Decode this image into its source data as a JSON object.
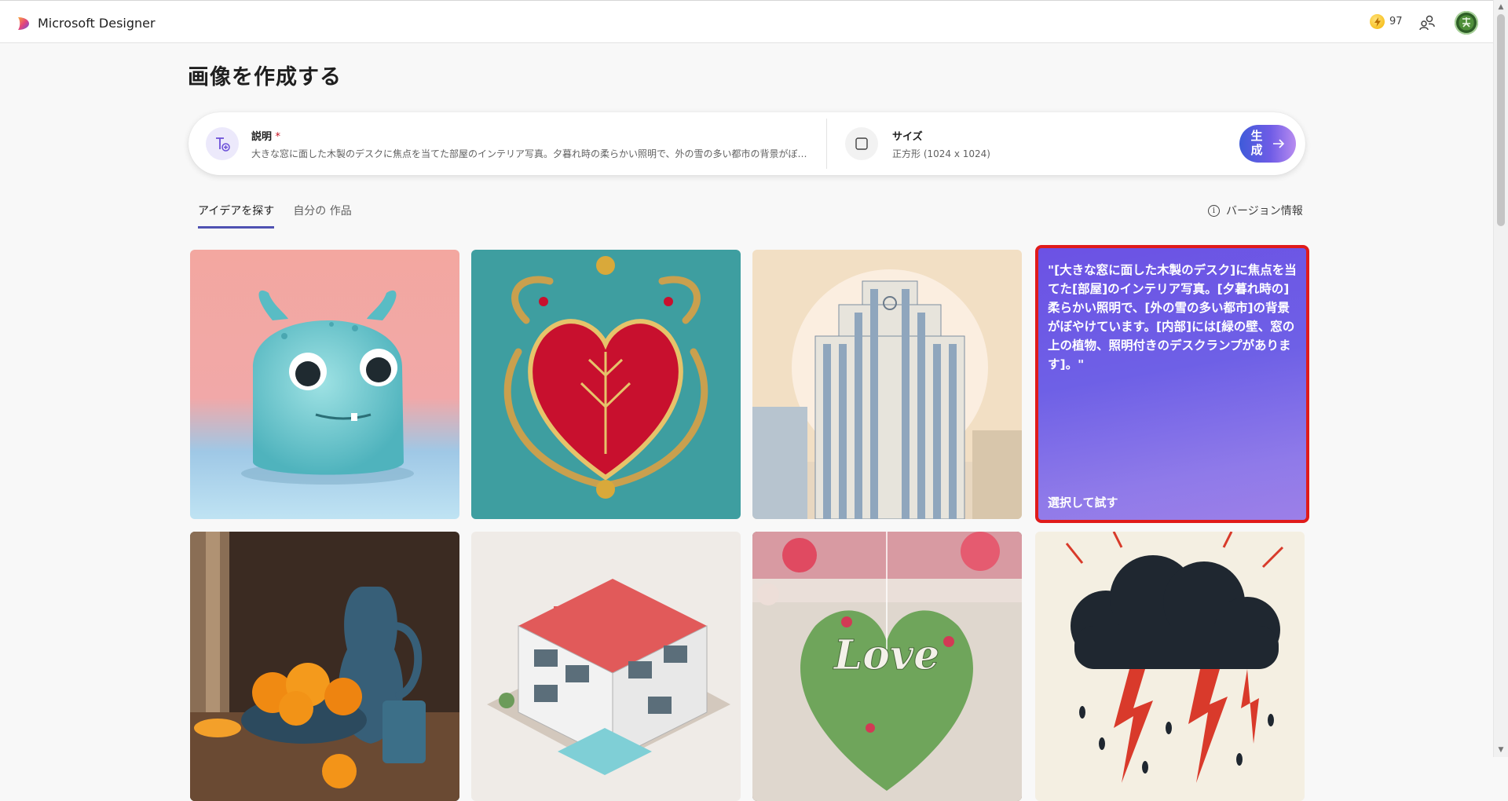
{
  "app": {
    "name": "Microsoft Designer",
    "credits": "97"
  },
  "page": {
    "title": "画像を作成する"
  },
  "prompt": {
    "description_label": "説明",
    "required_mark": "*",
    "description_text": "大きな窓に面した木製のデスクに焦点を当てた部屋のインテリア写真。夕暮れ時の柔らかい照明で、外の雪の多い都市の背景がぼやけています。内部には緑の壁、窓の上の植物、照明付きのデスクランプがあります。",
    "size_label": "サイズ",
    "size_value": "正方形 (1024 x 1024)",
    "generate_label": "生成"
  },
  "tabs": [
    {
      "label": "アイデアを探す",
      "active": true
    },
    {
      "label": "自分の 作品",
      "active": false
    }
  ],
  "version_info": "バージョン情報",
  "gallery": {
    "selected_prompt": "\"[大きな窓に面した木製のデスク]に焦点を当てた[部屋]のインテリア写真。[夕暮れ時の]柔らかい照明で、[外の雪の多い都市]の背景がぼやけています。[内部]には[緑の壁、窓の上の植物、照明付きのデスクランプがあります]。\"",
    "try_label": "選択して試す",
    "tiles": [
      {
        "name": "blue-monster-figure"
      },
      {
        "name": "embroidered-red-heart"
      },
      {
        "name": "art-deco-skyscraper"
      },
      {
        "name": "selected-prompt-tile"
      },
      {
        "name": "oranges-and-pitcher"
      },
      {
        "name": "isometric-house"
      },
      {
        "name": "paper-cut-love-heart"
      },
      {
        "name": "storm-cloud-lightning"
      }
    ],
    "love_word": "Love"
  },
  "colors": {
    "accent": "#4f52b2",
    "selection_border": "#e01b1b",
    "generate_gradient_start": "#3f5bd9",
    "generate_gradient_end": "#b88cf0"
  }
}
